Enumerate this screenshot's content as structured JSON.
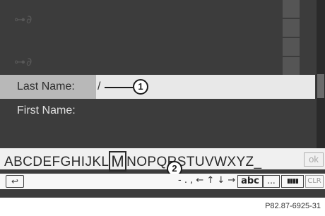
{
  "fields": {
    "last_name": {
      "label": "Last Name:",
      "value": "/"
    },
    "first_name": {
      "label": "First Name:",
      "value": ""
    }
  },
  "callouts": {
    "one": "1",
    "two": "2"
  },
  "keyboard": {
    "letters_before": "ABCDEFGHIJKL",
    "selected_letter": "M",
    "letters_after": "NOPQRSTUVWXYZ_",
    "ok_label": "ok",
    "specials": "- . , ← ↑ ↓ →",
    "abc_label": "abc",
    "more_label": "...",
    "layout_label": "▮▮▮▮",
    "clr_label": "CLR",
    "back_label": "↩"
  },
  "reference": "P82.87-6925-31",
  "icons": [
    "phone-book-icon",
    "back-icon",
    "arrow-left-icon",
    "arrow-up-icon",
    "arrow-down-icon",
    "arrow-right-icon"
  ]
}
